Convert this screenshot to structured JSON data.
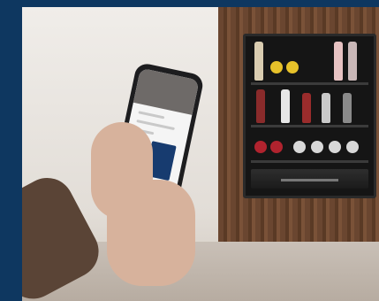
{
  "image": {
    "alt": "",
    "background_color": "#0e3760"
  }
}
